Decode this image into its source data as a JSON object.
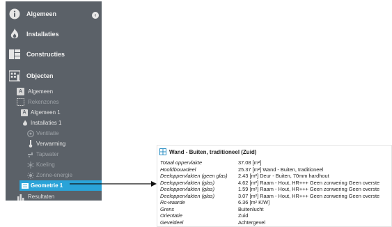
{
  "sidebar": {
    "main_items": [
      {
        "label": "Algemeen",
        "icon": "info-icon"
      },
      {
        "label": "Installaties",
        "icon": "flame-icon"
      },
      {
        "label": "Constructies",
        "icon": "constructions-icon"
      },
      {
        "label": "Objecten",
        "icon": "building-icon"
      }
    ],
    "sub_items": [
      {
        "label": "Algemeen",
        "badge": "A",
        "icon": "letter-a-icon"
      },
      {
        "label": "Rekenzones",
        "icon": "zones-icon"
      },
      {
        "label": "Algemeen 1",
        "badge": "A",
        "icon": "letter-a-icon"
      },
      {
        "label": "Installaties 1",
        "icon": "flame-icon"
      },
      {
        "label": "Ventilatie",
        "icon": "ventilation-icon"
      },
      {
        "label": "Verwarming",
        "icon": "thermometer-icon"
      },
      {
        "label": "Tapwater",
        "icon": "water-icon"
      },
      {
        "label": "Koeling",
        "icon": "snowflake-icon"
      },
      {
        "label": "Zonne-energie",
        "icon": "sun-icon"
      },
      {
        "label": "Geometrie 1",
        "icon": "geometry-icon"
      },
      {
        "label": "Resultaten",
        "icon": "chart-icon"
      }
    ]
  },
  "panel": {
    "title": "Wand - Buiten, traditioneel (Zuid)",
    "rows": [
      {
        "key": "Totaal oppervlakte",
        "value": "37.08 [m²]"
      },
      {
        "key": "Hoofdbouwdeel",
        "value": "25.37 [m²] Wand - Buiten, traditioneel"
      },
      {
        "key": "Deeloppervlakten (geen glas)",
        "value": "2.43 [m²] Deur - Buiten, 70mm hardhout"
      },
      {
        "key": "Deeloppervlakten (glas)",
        "value": "4.62 [m²] Raam - Hout, HR+++  Geen zonwering Geen overste"
      },
      {
        "key": "Deeloppervlakten (glas)",
        "value": "1.59 [m²] Raam - Hout, HR+++  Geen zonwering Geen overste"
      },
      {
        "key": "Deeloppervlakten (glas)",
        "value": "3.07 [m²] Raam - Hout, HR+++  Geen zonwering Geen overste"
      },
      {
        "key": "Rc-waarde",
        "value": "6.36 [m² K/W]"
      },
      {
        "key": "Grens",
        "value": "Buitenlucht"
      },
      {
        "key": "Orientatie",
        "value": "Zuid"
      },
      {
        "key": "Geveldeel",
        "value": "Achtergevel"
      }
    ]
  },
  "colors": {
    "sidebar_bg": "#5b6168",
    "selected_bg": "#2aa3d8",
    "text_light": "#f2f2f2"
  }
}
